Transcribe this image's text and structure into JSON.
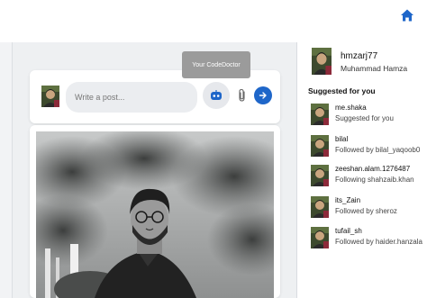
{
  "composer": {
    "placeholder": "Write a post...",
    "ai_tooltip": "Your CodeDoctor"
  },
  "profile": {
    "username": "hmzarj77",
    "full_name": "Muhammad Hamza"
  },
  "suggestions": {
    "heading": "Suggested for you",
    "items": [
      {
        "username": "me.shaka",
        "subtitle": "Suggested for you"
      },
      {
        "username": "bilal",
        "subtitle": "Followed by bilal_yaqoob0"
      },
      {
        "username": "zeeshan.alam.1276487",
        "subtitle": "Following shahzaib.khan"
      },
      {
        "username": "its_Zain",
        "subtitle": "Followed by sheroz"
      },
      {
        "username": "tufail_sh",
        "subtitle": "Followed by haider.hanzala"
      }
    ]
  },
  "icons": {
    "home": "home-icon",
    "ai": "robot-icon",
    "attach": "paperclip-icon",
    "send": "arrow-right-icon"
  },
  "colors": {
    "accent": "#1e66c9",
    "tooltip_bg": "#9b9b9b"
  }
}
